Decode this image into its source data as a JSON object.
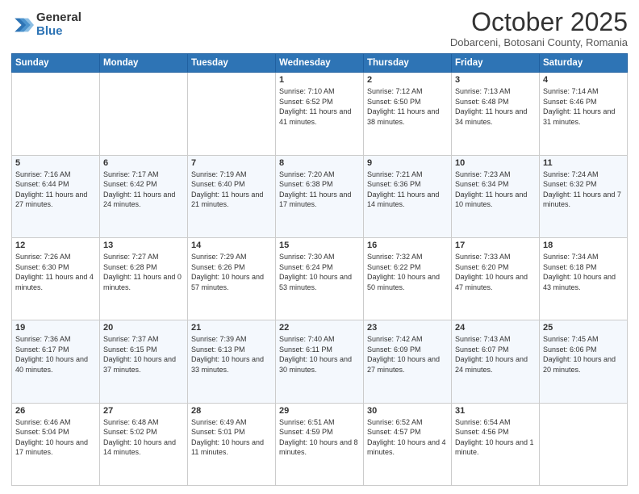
{
  "logo": {
    "general": "General",
    "blue": "Blue"
  },
  "header": {
    "month": "October 2025",
    "location": "Dobarceni, Botosani County, Romania"
  },
  "weekdays": [
    "Sunday",
    "Monday",
    "Tuesday",
    "Wednesday",
    "Thursday",
    "Friday",
    "Saturday"
  ],
  "weeks": [
    [
      {
        "day": "",
        "info": ""
      },
      {
        "day": "",
        "info": ""
      },
      {
        "day": "",
        "info": ""
      },
      {
        "day": "1",
        "info": "Sunrise: 7:10 AM\nSunset: 6:52 PM\nDaylight: 11 hours and 41 minutes."
      },
      {
        "day": "2",
        "info": "Sunrise: 7:12 AM\nSunset: 6:50 PM\nDaylight: 11 hours and 38 minutes."
      },
      {
        "day": "3",
        "info": "Sunrise: 7:13 AM\nSunset: 6:48 PM\nDaylight: 11 hours and 34 minutes."
      },
      {
        "day": "4",
        "info": "Sunrise: 7:14 AM\nSunset: 6:46 PM\nDaylight: 11 hours and 31 minutes."
      }
    ],
    [
      {
        "day": "5",
        "info": "Sunrise: 7:16 AM\nSunset: 6:44 PM\nDaylight: 11 hours and 27 minutes."
      },
      {
        "day": "6",
        "info": "Sunrise: 7:17 AM\nSunset: 6:42 PM\nDaylight: 11 hours and 24 minutes."
      },
      {
        "day": "7",
        "info": "Sunrise: 7:19 AM\nSunset: 6:40 PM\nDaylight: 11 hours and 21 minutes."
      },
      {
        "day": "8",
        "info": "Sunrise: 7:20 AM\nSunset: 6:38 PM\nDaylight: 11 hours and 17 minutes."
      },
      {
        "day": "9",
        "info": "Sunrise: 7:21 AM\nSunset: 6:36 PM\nDaylight: 11 hours and 14 minutes."
      },
      {
        "day": "10",
        "info": "Sunrise: 7:23 AM\nSunset: 6:34 PM\nDaylight: 11 hours and 10 minutes."
      },
      {
        "day": "11",
        "info": "Sunrise: 7:24 AM\nSunset: 6:32 PM\nDaylight: 11 hours and 7 minutes."
      }
    ],
    [
      {
        "day": "12",
        "info": "Sunrise: 7:26 AM\nSunset: 6:30 PM\nDaylight: 11 hours and 4 minutes."
      },
      {
        "day": "13",
        "info": "Sunrise: 7:27 AM\nSunset: 6:28 PM\nDaylight: 11 hours and 0 minutes."
      },
      {
        "day": "14",
        "info": "Sunrise: 7:29 AM\nSunset: 6:26 PM\nDaylight: 10 hours and 57 minutes."
      },
      {
        "day": "15",
        "info": "Sunrise: 7:30 AM\nSunset: 6:24 PM\nDaylight: 10 hours and 53 minutes."
      },
      {
        "day": "16",
        "info": "Sunrise: 7:32 AM\nSunset: 6:22 PM\nDaylight: 10 hours and 50 minutes."
      },
      {
        "day": "17",
        "info": "Sunrise: 7:33 AM\nSunset: 6:20 PM\nDaylight: 10 hours and 47 minutes."
      },
      {
        "day": "18",
        "info": "Sunrise: 7:34 AM\nSunset: 6:18 PM\nDaylight: 10 hours and 43 minutes."
      }
    ],
    [
      {
        "day": "19",
        "info": "Sunrise: 7:36 AM\nSunset: 6:17 PM\nDaylight: 10 hours and 40 minutes."
      },
      {
        "day": "20",
        "info": "Sunrise: 7:37 AM\nSunset: 6:15 PM\nDaylight: 10 hours and 37 minutes."
      },
      {
        "day": "21",
        "info": "Sunrise: 7:39 AM\nSunset: 6:13 PM\nDaylight: 10 hours and 33 minutes."
      },
      {
        "day": "22",
        "info": "Sunrise: 7:40 AM\nSunset: 6:11 PM\nDaylight: 10 hours and 30 minutes."
      },
      {
        "day": "23",
        "info": "Sunrise: 7:42 AM\nSunset: 6:09 PM\nDaylight: 10 hours and 27 minutes."
      },
      {
        "day": "24",
        "info": "Sunrise: 7:43 AM\nSunset: 6:07 PM\nDaylight: 10 hours and 24 minutes."
      },
      {
        "day": "25",
        "info": "Sunrise: 7:45 AM\nSunset: 6:06 PM\nDaylight: 10 hours and 20 minutes."
      }
    ],
    [
      {
        "day": "26",
        "info": "Sunrise: 6:46 AM\nSunset: 5:04 PM\nDaylight: 10 hours and 17 minutes."
      },
      {
        "day": "27",
        "info": "Sunrise: 6:48 AM\nSunset: 5:02 PM\nDaylight: 10 hours and 14 minutes."
      },
      {
        "day": "28",
        "info": "Sunrise: 6:49 AM\nSunset: 5:01 PM\nDaylight: 10 hours and 11 minutes."
      },
      {
        "day": "29",
        "info": "Sunrise: 6:51 AM\nSunset: 4:59 PM\nDaylight: 10 hours and 8 minutes."
      },
      {
        "day": "30",
        "info": "Sunrise: 6:52 AM\nSunset: 4:57 PM\nDaylight: 10 hours and 4 minutes."
      },
      {
        "day": "31",
        "info": "Sunrise: 6:54 AM\nSunset: 4:56 PM\nDaylight: 10 hours and 1 minute."
      },
      {
        "day": "",
        "info": ""
      }
    ]
  ]
}
